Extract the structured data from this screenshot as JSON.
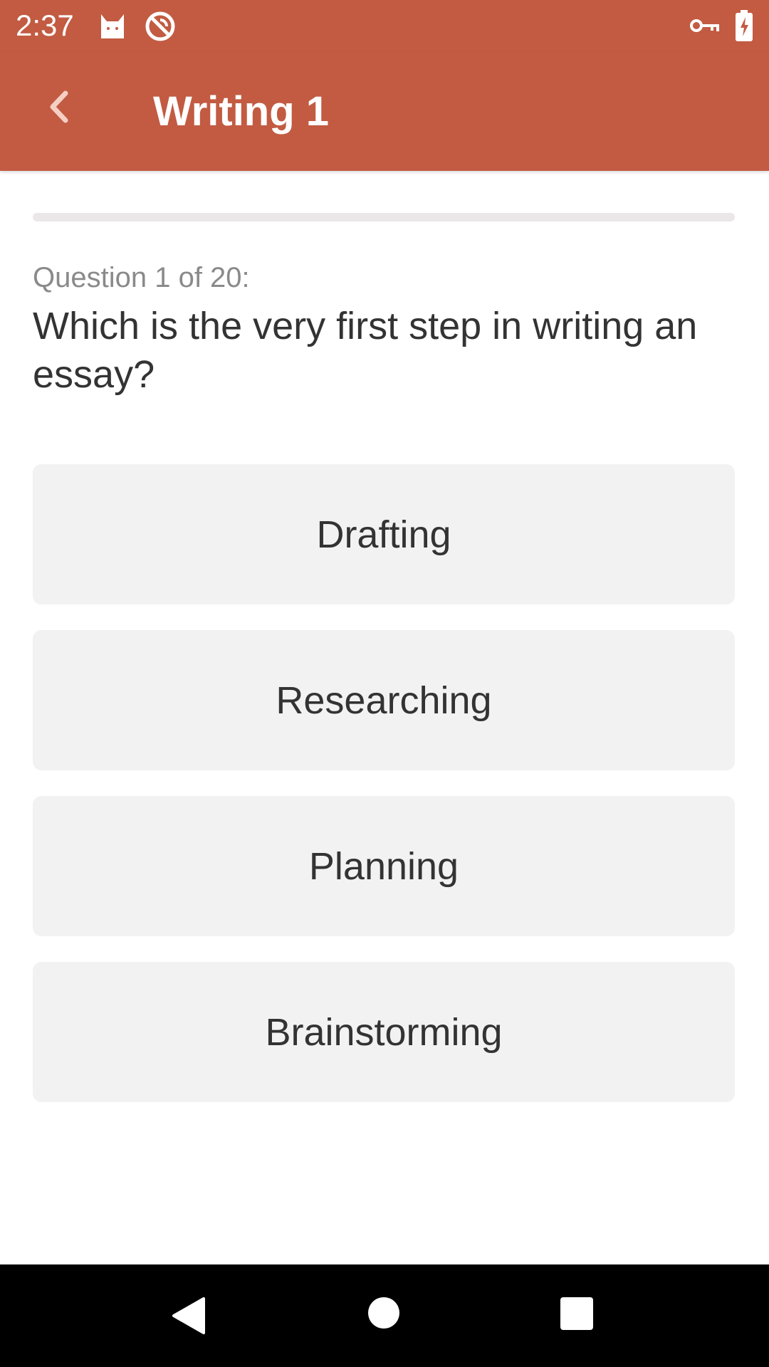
{
  "status_bar": {
    "time": "2:37",
    "icons": [
      "cat-icon",
      "no-sync-icon",
      "key-icon",
      "battery-charging-icon"
    ]
  },
  "app_bar": {
    "title": "Writing 1",
    "back_icon": "chevron-left-icon",
    "color": "#c25b42"
  },
  "quiz": {
    "progress": 0,
    "counter": "Question 1 of 20:",
    "question": "Which is the very first step in writing an essay?",
    "answers": [
      "Drafting",
      "Researching",
      "Planning",
      "Brainstorming"
    ]
  },
  "nav_bar": {
    "buttons": [
      "back-triangle-icon",
      "home-circle-icon",
      "recents-square-icon"
    ]
  }
}
